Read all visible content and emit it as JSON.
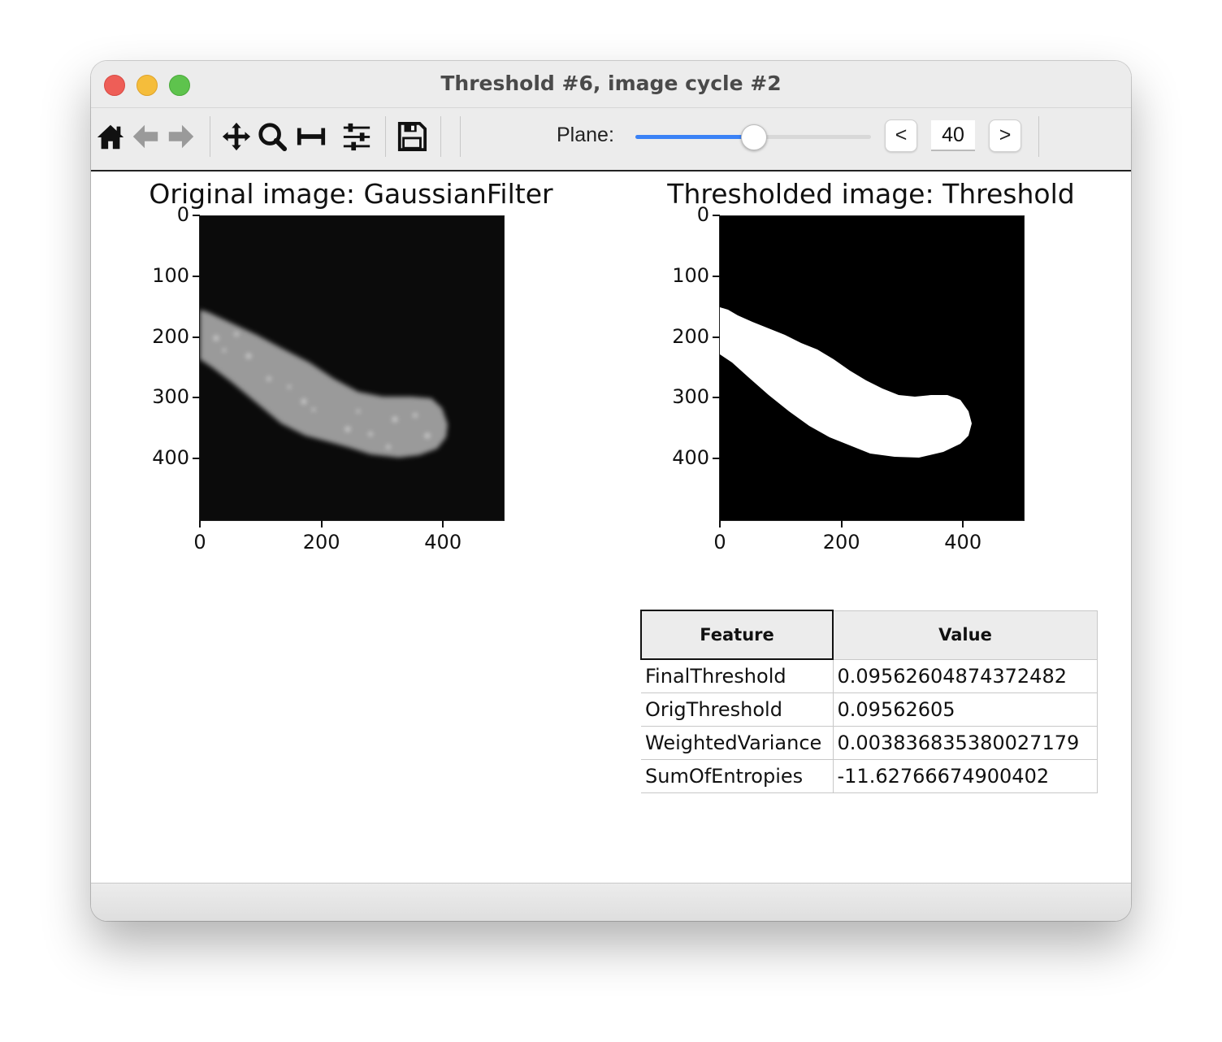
{
  "window": {
    "title": "Threshold #6, image cycle #2"
  },
  "toolbar": {
    "icons": [
      "home-icon",
      "back-arrow-icon",
      "forward-arrow-icon",
      "pan-icon",
      "zoom-icon",
      "measure-icon",
      "sliders-icon",
      "save-icon"
    ],
    "plane_label": "Plane:",
    "plane_value": "40",
    "plane_fraction": 0.5,
    "prev_label": "<",
    "next_label": ">",
    "accent_color": "#3b82f6"
  },
  "plots": [
    {
      "title": "Original image: GaussianFilter",
      "image": "grayscale cell",
      "y_ticks": [
        "0",
        "100",
        "200",
        "300",
        "400"
      ],
      "x_ticks": [
        "0",
        "200",
        "400"
      ]
    },
    {
      "title": "Thresholded image: Threshold",
      "image": "binary mask",
      "y_ticks": [
        "0",
        "100",
        "200",
        "300",
        "400"
      ],
      "x_ticks": [
        "0",
        "200",
        "400"
      ]
    }
  ],
  "table": {
    "headers": [
      "Feature",
      "Value"
    ],
    "rows": [
      [
        "FinalThreshold",
        "0.09562604874372482"
      ],
      [
        "OrigThreshold",
        "0.09562605"
      ],
      [
        "WeightedVariance",
        "0.003836835380027179"
      ],
      [
        "SumOfEntropies",
        "-11.62766674900402"
      ]
    ]
  }
}
